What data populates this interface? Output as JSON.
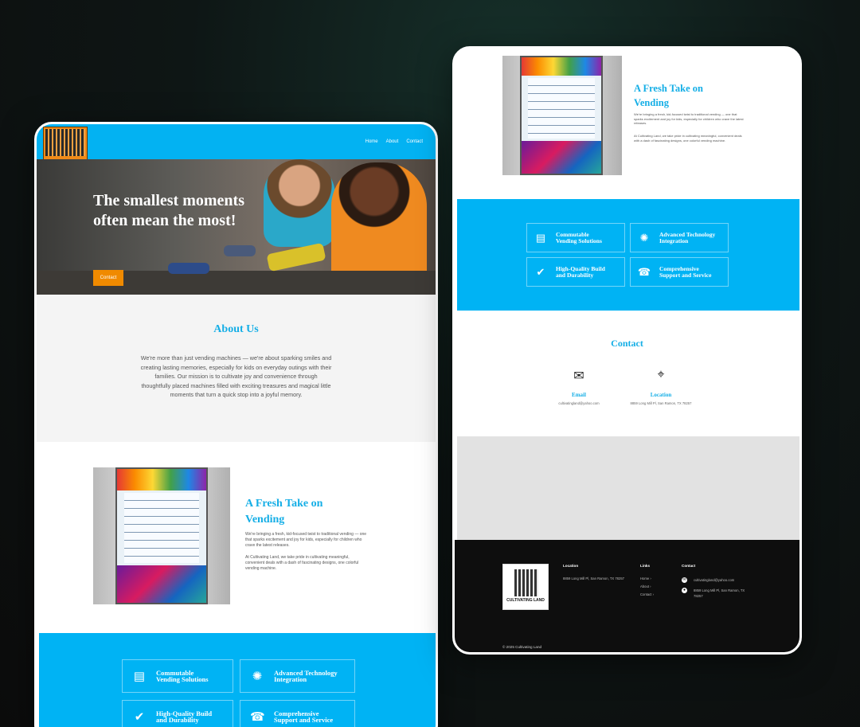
{
  "nav": {
    "links": [
      "Home",
      "About",
      "Contact"
    ]
  },
  "logo": {
    "text": "CULTIVATING LAND"
  },
  "hero": {
    "title_line1": "The smallest moments",
    "title_line2": "often mean the most!",
    "button": "Contact"
  },
  "about": {
    "heading": "About Us",
    "body": "We're more than just vending machines — we're about sparking smiles and creating lasting memories, especially for kids on everyday outings with their families. Our mission is to cultivate joy and convenience through thoughtfully placed machines filled with exciting treasures and magical little moments that turn a quick stop into a joyful memory."
  },
  "fresh": {
    "heading_line1": "A Fresh Take on",
    "heading_line2": "Vending",
    "p1": "We're bringing a fresh, kid-focused twist to traditional vending — one that sparks excitement and joy for kids, especially for children who crave the latest releases.",
    "p2": "At Cultivating Land, we take pride in cultivating meaningful, convenient deals with a dash of fascinating designs, one colorful vending machine."
  },
  "services": [
    {
      "icon": "vending",
      "line1": "Commutable",
      "line2": "Vending Solutions"
    },
    {
      "icon": "tech",
      "line1": "Advanced Technology",
      "line2": "Integration"
    },
    {
      "icon": "quality",
      "line1": "High-Quality Build",
      "line2": "and Durability"
    },
    {
      "icon": "support",
      "line1": "Comprehensive",
      "line2": "Support and Service"
    }
  ],
  "contact": {
    "heading": "Contact",
    "email_label": "Email",
    "email_value": "cultivatingland@yahoo.com",
    "location_label": "Location",
    "location_value": "8859 Long Mill Pl, San Ramon, TX 78257"
  },
  "footer": {
    "location_head": "Location",
    "location_text": "8859 Long Mill Pl, San Ramon, TX 78257",
    "links_head": "Links",
    "links": [
      "Home",
      "About",
      "Contact"
    ],
    "contact_head": "Contact",
    "contact_email": "cultivatingland@yahoo.com",
    "contact_address": "8859 Long Mill Pl, San Ramon, TX 78257",
    "copyright": "© 2025 Cultivating Land"
  },
  "colors": {
    "brand_blue": "#00b3f4",
    "heading_blue": "#14aee6",
    "accent_orange": "#f08a00",
    "footer_bg": "#0e0e0e"
  }
}
